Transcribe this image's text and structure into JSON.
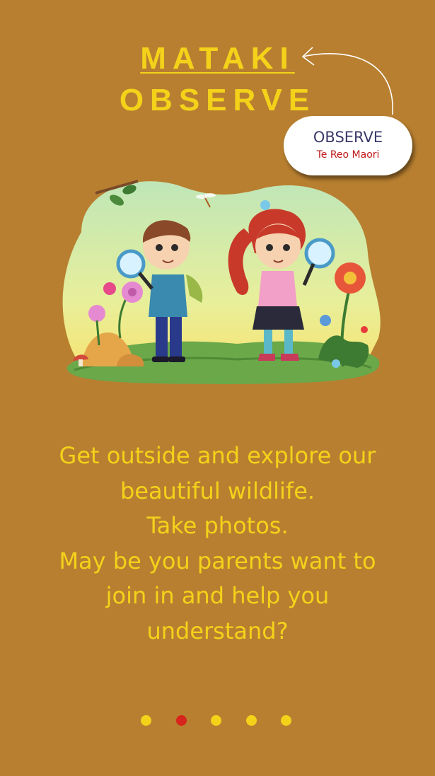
{
  "header": {
    "title_maori": "MATAKI",
    "title_english": "OBSERVE"
  },
  "translation_bubble": {
    "word": "OBSERVE",
    "language": "Te Reo Maori"
  },
  "illustration": {
    "alt": "Two children exploring nature with magnifying glasses"
  },
  "description": {
    "lines": [
      "Get outside and explore our",
      "beautiful wildlife.",
      "Take photos.",
      "May be you parents want to",
      "join in and help you",
      "understand?"
    ]
  },
  "pagination": {
    "total": 5,
    "active_index": 1
  },
  "colors": {
    "background": "#b87f30",
    "accent": "#f4d21a",
    "active_dot": "#d7241c"
  }
}
